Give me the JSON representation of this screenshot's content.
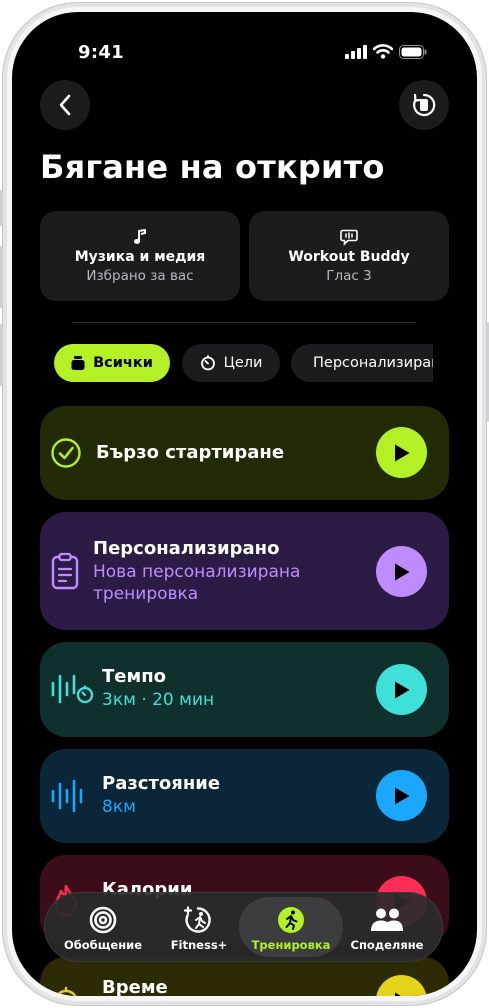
{
  "status_bar": {
    "time": "9:41"
  },
  "header": {
    "title": "Бягане на открито"
  },
  "tiles": {
    "music": {
      "title": "Музика и медия",
      "subtitle": "Избрано за вас",
      "icon": "music-note-icon"
    },
    "buddy": {
      "title": "Workout Buddy",
      "subtitle": "Глас 3",
      "icon": "speech-bubble-icon"
    }
  },
  "filters": [
    {
      "label": "Всички",
      "icon": "stack-icon",
      "selected": true
    },
    {
      "label": "Цели",
      "icon": "timer-icon",
      "selected": false
    },
    {
      "label": "Персонализирано",
      "icon": "clipboard-icon",
      "selected": false
    }
  ],
  "workouts": [
    {
      "title": "Бързо стартиране",
      "subtitle": "",
      "color": "#b4f026",
      "icon": "checkmark-circle-icon"
    },
    {
      "title": "Персонализирано",
      "subtitle": "Нова персонализирана тренировка",
      "color": "#bf8cff",
      "icon": "clipboard-icon"
    },
    {
      "title": "Темпо",
      "subtitle": "3км · 20 мин",
      "color": "#3ee0d7",
      "icon": "pace-icon"
    },
    {
      "title": "Разстояние",
      "subtitle": "8км",
      "color": "#1aa8ff",
      "icon": "distance-icon"
    },
    {
      "title": "Калории",
      "subtitle": "",
      "color": "#ff2d55",
      "icon": "flame-icon"
    },
    {
      "title": "Време",
      "subtitle": "",
      "color": "#e5d31a",
      "icon": "stopwatch-icon"
    }
  ],
  "tab_bar": {
    "active_color": "#b4f026",
    "tabs": [
      {
        "label": "Обобщение",
        "icon": "activity-rings-icon"
      },
      {
        "label": "Fitness+",
        "icon": "fitness-plus-icon"
      },
      {
        "label": "Тренировка",
        "icon": "running-figure-icon",
        "selected": true
      },
      {
        "label": "Споделяне",
        "icon": "people-icon"
      }
    ]
  }
}
